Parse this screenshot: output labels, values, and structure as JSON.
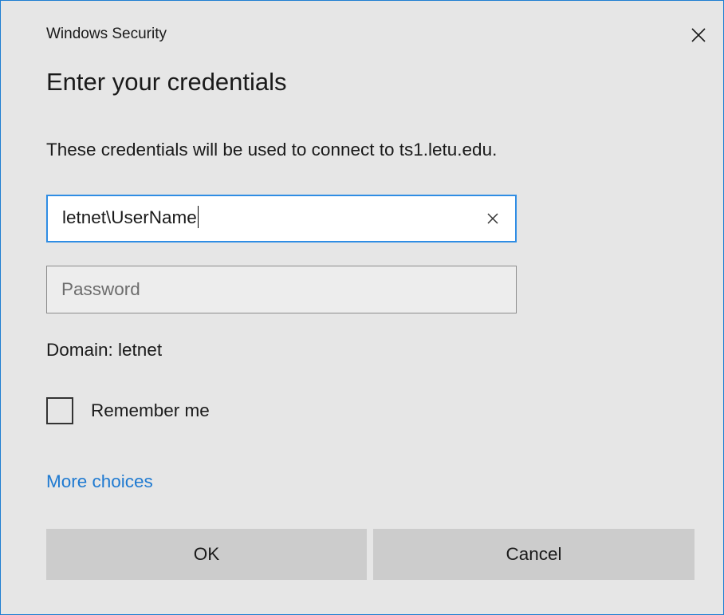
{
  "window": {
    "title": "Windows Security",
    "accent_color": "#1e7ed1"
  },
  "dialog": {
    "heading": "Enter your credentials",
    "description": "These credentials will be used to connect to ts1.letu.edu.",
    "username": {
      "value": "letnet\\UserName",
      "clear_icon": "close-icon"
    },
    "password": {
      "value": "",
      "placeholder": "Password"
    },
    "domain_text": "Domain: letnet",
    "remember_me": {
      "label": "Remember me",
      "checked": false
    },
    "more_choices_label": "More choices",
    "link_color": "#1f7ad1",
    "buttons": {
      "ok_label": "OK",
      "cancel_label": "Cancel"
    }
  }
}
